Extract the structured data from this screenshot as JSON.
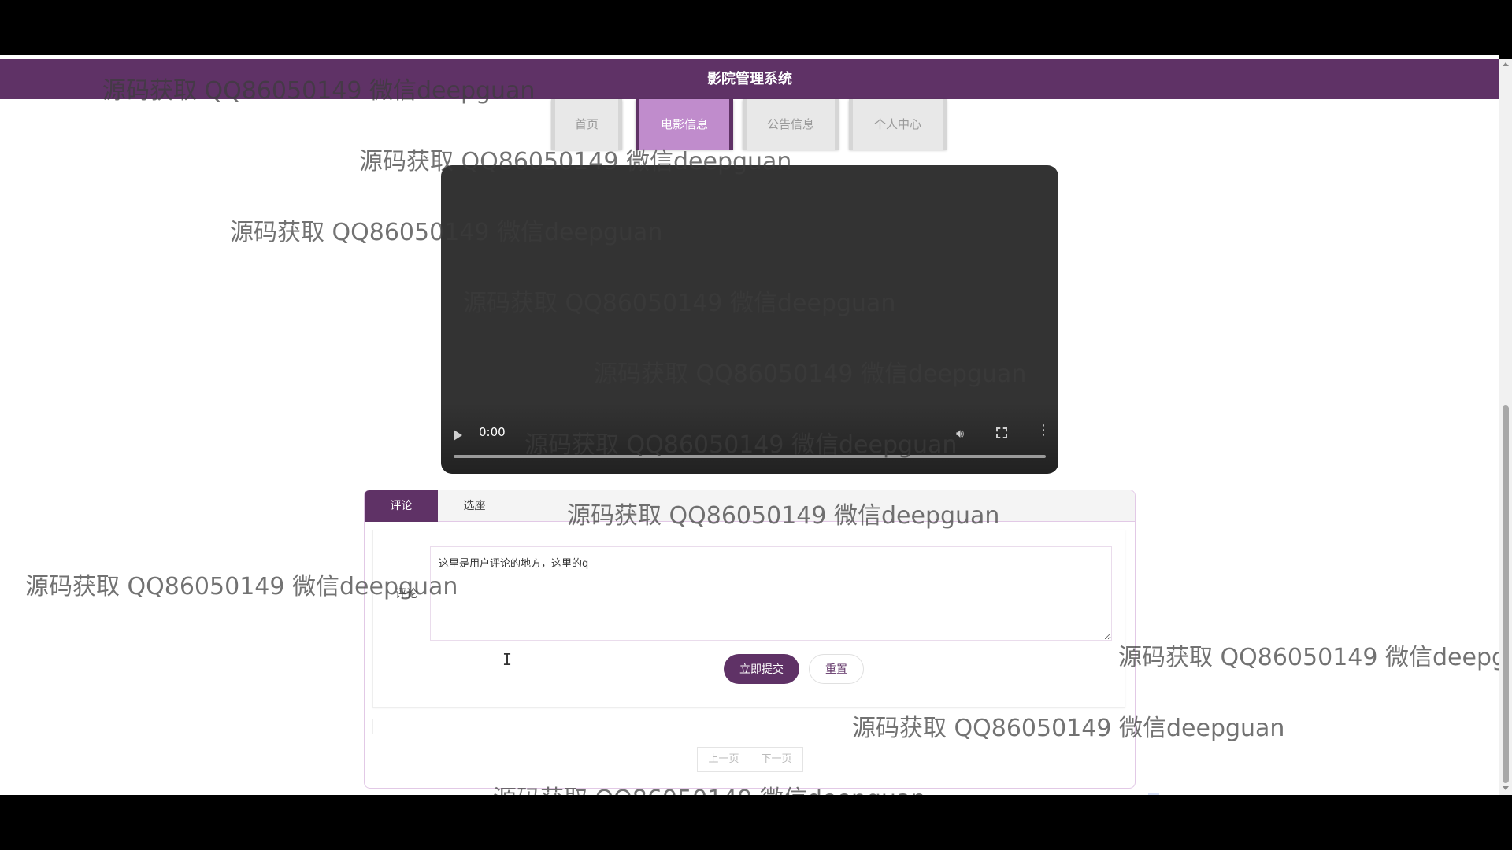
{
  "header": {
    "title": "影院管理系统"
  },
  "nav": {
    "items": [
      {
        "label": "首页"
      },
      {
        "label": "电影信息"
      },
      {
        "label": "公告信息"
      },
      {
        "label": "个人中心"
      }
    ],
    "active": "电影信息"
  },
  "video": {
    "time": "0:00"
  },
  "panel": {
    "tabs": [
      {
        "label": "评论"
      },
      {
        "label": "选座"
      }
    ],
    "active_tab": "评论",
    "form": {
      "label": "评论",
      "value": "这里是用户评论的地方，这里的q",
      "submit_label": "立即提交",
      "reset_label": "重置"
    },
    "pager": {
      "prev_label": "上一页",
      "next_label": "下一页"
    }
  },
  "watermark": {
    "text": "源码获取 QQ86050149 微信deepguan"
  },
  "colors": {
    "brand": "#5f3266",
    "active_tab_bg": "#c08ccc"
  }
}
